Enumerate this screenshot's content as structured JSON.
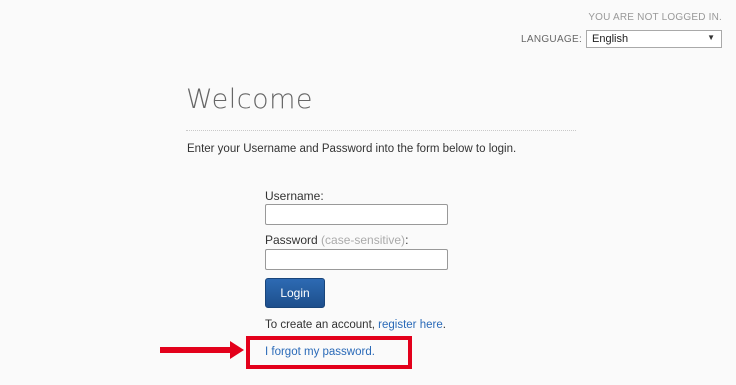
{
  "header": {
    "login_status": "YOU ARE NOT LOGGED IN.",
    "language_label": "LANGUAGE:",
    "language_selected": "English"
  },
  "main": {
    "title": "Welcome",
    "instructions": "Enter your Username and Password into the form below to login."
  },
  "form": {
    "username_label": "Username:",
    "username_value": "",
    "password_label": "Password",
    "password_hint": "(case-sensitive)",
    "password_label_suffix": ":",
    "password_value": "",
    "login_button": "Login"
  },
  "links": {
    "register_prefix": "To create an account, ",
    "register_link": "register here",
    "register_suffix": ".",
    "forgot_password": "I forgot my password."
  },
  "annotation": {
    "color": "#e3001b"
  },
  "colors": {
    "link": "#2a6ab8",
    "button": "#1d4f8c"
  }
}
